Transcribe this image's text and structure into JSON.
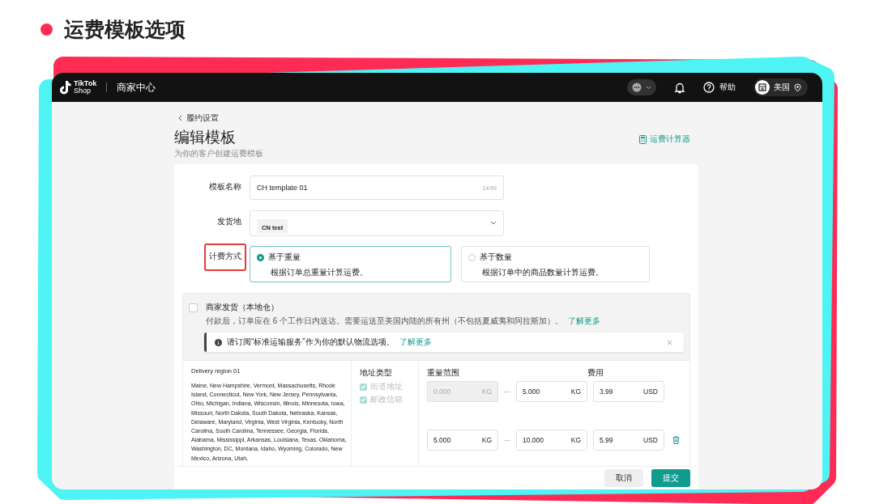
{
  "heading": "运费模板选项",
  "topbar": {
    "logo_line1": "TikTok",
    "logo_line2": "Shop",
    "app_name": "商家中心",
    "help": "帮助",
    "region": "美国"
  },
  "breadcrumb": "履约设置",
  "title": "编辑模板",
  "subtitle": "为你的客户创建运费模板",
  "calculator_link": "运费计算器",
  "form": {
    "name_label": "模板名称",
    "name_value": "CH template 01",
    "name_count": "14/99",
    "origin_label": "发货地",
    "origin_tag": "CN test",
    "billing_label": "计费方式",
    "billing_annotated": true,
    "billing_options": [
      {
        "title": "基于重量",
        "desc": "根据订单总重量计算运费。",
        "selected": true
      },
      {
        "title": "基于数量",
        "desc": "根据订单中的商品数量计算运费。",
        "selected": false
      }
    ]
  },
  "section": {
    "checked": false,
    "title": "商家发货（本地仓）",
    "desc": "付款后，订单应在 6 个工作日内送达。需要运送至美国内陆的所有州（不包括夏威夷和阿拉斯加）。",
    "link": "了解更多",
    "alert": {
      "text": "请订阅“标准运输服务”作为你的默认物流选项。",
      "link": "了解更多"
    }
  },
  "region": {
    "name": "Delivery region 01",
    "states": "Maine, New Hampshire, Vermont, Massachusetts, Rhode Island, Connecticut, New York, New Jersey, Pennsylvania, Ohio, Michigan, Indiana, Wisconsin, Illinois, Minnesota, Iowa, Missouri, North Dakota, South Dakota, Nebraska, Kansas, Delaware, Maryland, Virginia, West Virginia, Kentucky, North Carolina, South Carolina, Tennessee, Georgia, Florida, Alabama, Mississippi, Arkansas, Louisiana, Texas, Oklahoma, Washington, DC, Montana, Idaho, Wyoming, Colorado, New Mexico, Arizona, Utah,",
    "address_type_label": "地址类型",
    "address_types": [
      {
        "label": "街道地址",
        "checked": true,
        "disabled": true
      },
      {
        "label": "邮政信箱",
        "checked": true,
        "disabled": true
      }
    ],
    "weight_label": "重量范围",
    "fee_label": "费用",
    "tiers": [
      {
        "from": "0.000",
        "from_disabled": true,
        "from_unit": "KG",
        "to": "5.000",
        "to_unit": "KG",
        "fee": "3.99",
        "currency": "USD",
        "deletable": false
      },
      {
        "from": "5.000",
        "from_disabled": false,
        "from_unit": "KG",
        "to": "10.000",
        "to_unit": "KG",
        "fee": "5.99",
        "currency": "USD",
        "deletable": true
      }
    ]
  },
  "buttons": [
    {
      "label": "取消",
      "kind": "secondary"
    },
    {
      "label": "提交",
      "kind": "primary"
    }
  ]
}
